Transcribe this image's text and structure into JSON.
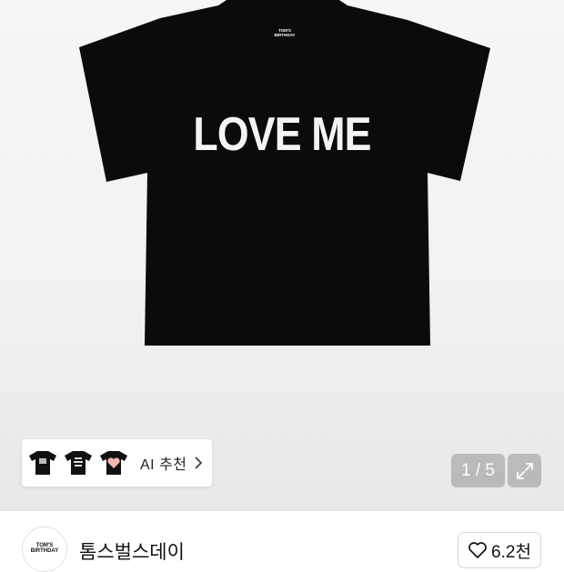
{
  "product": {
    "print_text": "LOVE ME",
    "neck_label_line1": "TOM'S",
    "neck_label_line2": "BIRTHDAY"
  },
  "ai_recommend": {
    "label": "AI 추천",
    "thumbnails": [
      "black-tee-graphic",
      "black-tee-text",
      "black-tee-heart"
    ]
  },
  "gallery": {
    "counter": "1 / 5"
  },
  "brand": {
    "logo_line1": "TOM'S",
    "logo_line2": "BIRTHDAY",
    "name": "톰스벌스데이",
    "like_count": "6.2천"
  },
  "icons": {
    "chevron": "chevron-right-icon",
    "expand": "expand-icon",
    "heart": "heart-icon"
  }
}
